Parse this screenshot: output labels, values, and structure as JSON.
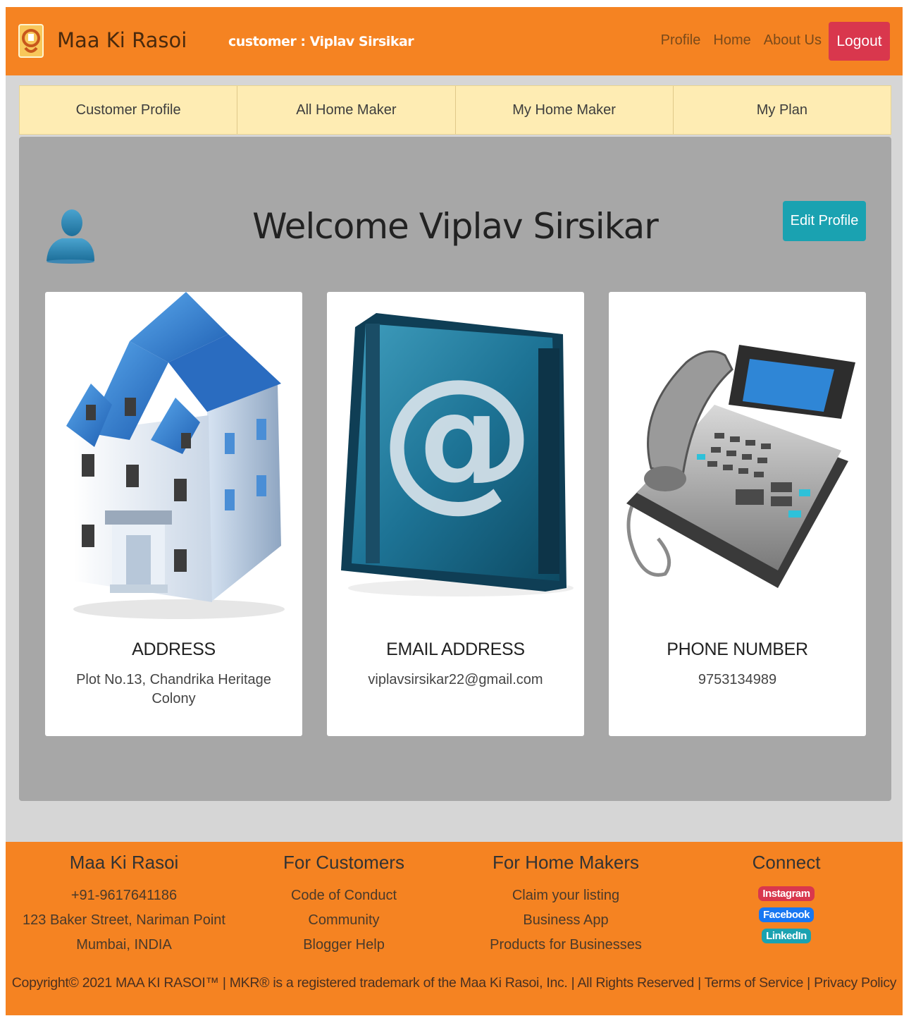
{
  "navbar": {
    "brand": "Maa Ki Rasoi",
    "customer_label": "customer : Viplav Sirsikar",
    "links": [
      "Profile",
      "Home",
      "About Us"
    ],
    "logout": "Logout"
  },
  "tabs": [
    "Customer Profile",
    "All Home Maker",
    "My Home Maker",
    "My Plan"
  ],
  "main": {
    "welcome": "Welcome Viplav Sirsikar",
    "edit_profile": "Edit Profile",
    "cards": [
      {
        "title": "ADDRESS",
        "value": "Plot No.13, Chandrika Heritage Colony",
        "icon": "house-icon"
      },
      {
        "title": "EMAIL ADDRESS",
        "value": "viplavsirsikar22@gmail.com",
        "icon": "email-book-icon"
      },
      {
        "title": "PHONE NUMBER",
        "value": "9753134989",
        "icon": "telephone-icon"
      }
    ]
  },
  "footer": {
    "brand": {
      "title": "Maa Ki Rasoi",
      "lines": [
        "+91-9617641186",
        "123 Baker Street, Nariman Point",
        "Mumbai, INDIA"
      ]
    },
    "customers": {
      "title": "For Customers",
      "links": [
        "Code of Conduct",
        "Community",
        "Blogger Help"
      ]
    },
    "homemakers": {
      "title": "For Home Makers",
      "links": [
        "Claim your listing",
        "Business App",
        "Products for Businesses"
      ]
    },
    "connect": {
      "title": "Connect",
      "badges": [
        "Instagram",
        "Facebook",
        "LinkedIn"
      ]
    },
    "copyright": "Copyright© 2021 MAA KI RASOI™ | MKR® is a registered trademark of the Maa Ki Rasoi, Inc. | All Rights Reserved | Terms of Service | Privacy Policy"
  },
  "colors": {
    "brand_orange": "#f58322",
    "tab_bg": "#feecb3",
    "panel_gray": "#a7a7a7",
    "logout_red": "#d9374d",
    "edit_teal": "#1aa2b1",
    "instagram": "#d9374d",
    "facebook": "#1877f2",
    "linkedin": "#1aa2b1"
  }
}
